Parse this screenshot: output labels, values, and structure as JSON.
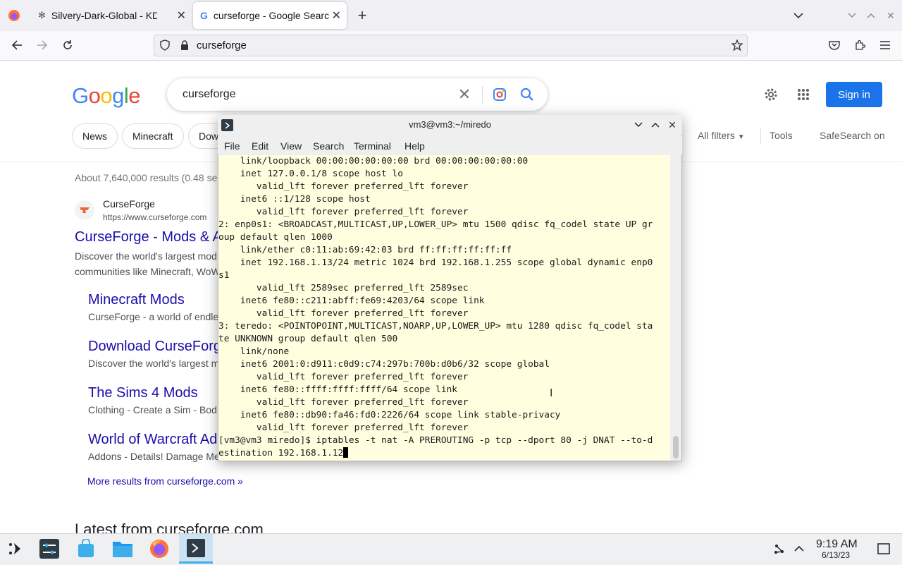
{
  "browser": {
    "tabs": [
      {
        "title": "Silvery-Dark-Global - KDE S",
        "active": false
      },
      {
        "title": "curseforge - Google Search",
        "active": true
      }
    ],
    "url": "curseforge"
  },
  "google": {
    "query": "curseforge",
    "sign_in": "Sign in",
    "chips": [
      "News",
      "Minecraft",
      "Dow"
    ],
    "all_filters": "All filters",
    "tools": "Tools",
    "safesearch": "SafeSearch on",
    "stats": "About 7,640,000 results (0.48 se",
    "result": {
      "site_name": "CurseForge",
      "site_url": "https://www.curseforge.com",
      "title": "CurseForge - Mods & A",
      "snippet_1": "Discover the world's largest mod",
      "snippet_2": "communities like Minecraft, WoW"
    },
    "sitelinks": [
      {
        "title": "Minecraft Mods",
        "snippet": "CurseForge - a world of endle"
      },
      {
        "title": "Download CurseForg",
        "snippet": "Discover the world's largest m"
      },
      {
        "title": "The Sims 4 Mods",
        "snippet": "Clothing - Create a Sim - Bod"
      },
      {
        "title": "World of Warcraft Ad",
        "snippet": "Addons - Details! Damage Me"
      }
    ],
    "more_results": "More results from curseforge.com »",
    "latest": "Latest from curseforge.com"
  },
  "terminal": {
    "title": "vm3@vm3:~/miredo",
    "menu": [
      "File",
      "Edit",
      "View",
      "Search",
      "Terminal",
      "Help"
    ],
    "lines": [
      "    link/loopback 00:00:00:00:00:00 brd 00:00:00:00:00:00",
      "    inet 127.0.0.1/8 scope host lo",
      "       valid_lft forever preferred_lft forever",
      "    inet6 ::1/128 scope host",
      "       valid_lft forever preferred_lft forever",
      "2: enp0s1: <BROADCAST,MULTICAST,UP,LOWER_UP> mtu 1500 qdisc fq_codel state UP gr",
      "oup default qlen 1000",
      "    link/ether c0:11:ab:69:42:03 brd ff:ff:ff:ff:ff:ff",
      "    inet 192.168.1.13/24 metric 1024 brd 192.168.1.255 scope global dynamic enp0",
      "s1",
      "       valid_lft 2589sec preferred_lft 2589sec",
      "    inet6 fe80::c211:abff:fe69:4203/64 scope link",
      "       valid_lft forever preferred_lft forever",
      "3: teredo: <POINTOPOINT,MULTICAST,NOARP,UP,LOWER_UP> mtu 1280 qdisc fq_codel sta",
      "te UNKNOWN group default qlen 500",
      "    link/none",
      "    inet6 2001:0:d911:c0d9:c74:297b:700b:d0b6/32 scope global",
      "       valid_lft forever preferred_lft forever",
      "    inet6 fe80::ffff:ffff:ffff/64 scope link",
      "       valid_lft forever preferred_lft forever",
      "    inet6 fe80::db90:fa46:fd0:2226/64 scope link stable-privacy",
      "       valid_lft forever preferred_lft forever",
      "[vm3@vm3 miredo]$ iptables -t nat -A PREROUTING -p tcp --dport 80 -j DNAT --to-d",
      "estination 192.168.1.12"
    ]
  },
  "taskbar": {
    "time": "9:19 AM",
    "date": "6/13/23"
  },
  "colors": {
    "google_blue": "#1a73e8",
    "link_blue": "#1a0dab",
    "terminal_bg": "#ffffe0"
  }
}
